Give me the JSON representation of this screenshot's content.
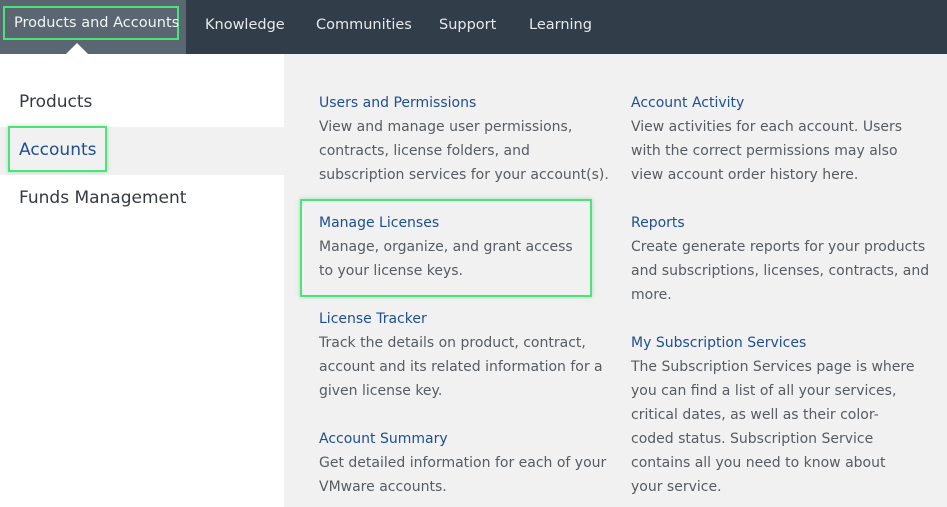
{
  "topnav": {
    "items": [
      {
        "label": "Products and Accounts",
        "active": true
      },
      {
        "label": "Knowledge"
      },
      {
        "label": "Communities"
      },
      {
        "label": "Support"
      },
      {
        "label": "Learning"
      }
    ]
  },
  "sidebar": {
    "items": [
      {
        "label": "Products"
      },
      {
        "label": "Accounts",
        "active": true
      },
      {
        "label": "Funds Management"
      }
    ]
  },
  "cards": {
    "users": {
      "title": "Users and Permissions",
      "desc": "View and manage user permissions, contracts, license folders, and subscription services for your account(s)."
    },
    "activity": {
      "title": "Account Activity",
      "desc": "View activities for each account. Users with the correct permissions may also view account order history here."
    },
    "licenses": {
      "title": "Manage Licenses",
      "desc": "Manage, organize, and grant access to your license keys."
    },
    "reports": {
      "title": "Reports",
      "desc": "Create generate reports for your products and subscriptions, licenses, contracts, and more."
    },
    "tracker": {
      "title": "License Tracker",
      "desc": "Track the details on product, contract, account and its related information for a given license key."
    },
    "subscriptions": {
      "title": "My Subscription Services",
      "desc": "The Subscription Services page is where you can find a list of all your services, critical dates, as well as their color-coded status. Subscription Service contains all you need to know about your service."
    },
    "summary": {
      "title": "Account Summary",
      "desc": "Get detailed information for each of your VMware accounts."
    }
  },
  "colors": {
    "nav_bg": "#313e4a",
    "nav_active_bg": "#5a6772",
    "highlight": "#4ee37a",
    "link": "#1d4f91",
    "panel_bg": "#f1f1f1"
  }
}
